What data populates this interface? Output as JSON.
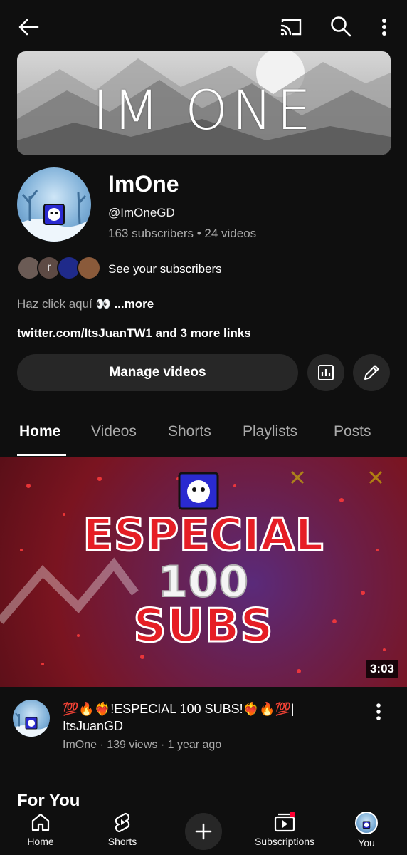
{
  "topbar": {
    "back_icon": "arrow-left-icon",
    "cast_icon": "cast-icon",
    "search_icon": "search-icon",
    "more_icon": "more-vertical-icon"
  },
  "banner": {
    "title": "IM ONE"
  },
  "channel": {
    "name": "ImOne",
    "handle": "@ImOneGD",
    "stats": "163 subscribers • 24 videos",
    "subscriber_initial": "r",
    "see_subscribers": "See your subscribers",
    "description": "Haz click aquí 👀",
    "more": "...more",
    "links": "twitter.com/ItsJuanTW1 and 3 more links",
    "manage_videos": "Manage videos"
  },
  "tabs": [
    {
      "label": "Home"
    },
    {
      "label": "Videos"
    },
    {
      "label": "Shorts"
    },
    {
      "label": "Playlists"
    },
    {
      "label": "Posts"
    }
  ],
  "video": {
    "thumb_line1": "ESPECIAL",
    "thumb_line2": "100",
    "thumb_line3": "SUBS",
    "duration": "3:03",
    "title": "💯🔥❤️‍🔥!ESPECIAL 100 SUBS!❤️‍🔥🔥💯| ItsJuanGD",
    "meta": "ImOne · 139 views · 1 year ago"
  },
  "section": {
    "for_you": "For You"
  },
  "bottom_nav": {
    "home": "Home",
    "shorts": "Shorts",
    "subscriptions": "Subscriptions",
    "you": "You"
  },
  "colors": {
    "background": "#0f0f0f",
    "surface": "#272727",
    "secondary_text": "#aaaaaa",
    "notification_dot": "#ff0033"
  }
}
